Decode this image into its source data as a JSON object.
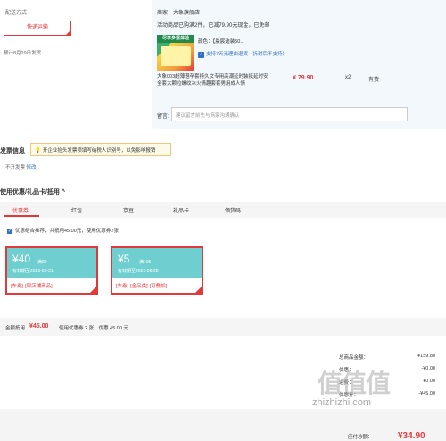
{
  "shipping": {
    "title": "配送方式",
    "method": "快递运输",
    "date": "预计8月29日发货"
  },
  "order": {
    "merchant": "商家：大象旗舰店",
    "promo": "活动商品已购满2件，已减79.90元现金，已免邮",
    "thumb_text": "尽享多重体验",
    "color_line": "颜色：【晨宸迪装50...",
    "guarantee": "支持7天无理由退货（拆封后不支持）",
    "guarantee_icon": "shield-check-icon",
    "product_name": "大象003超薄避孕套持久女专用高潮延时装挺延时安全套大颗粒螺纹冰火情趣套套男用成人情",
    "price": "¥ 79.90",
    "qty": "x2",
    "stock": "有货",
    "note_label": "留言:",
    "note_placeholder": "建议留言前先与商家沟通确认"
  },
  "invoice": {
    "title": "发票信息",
    "tip": "开企业抬头发票须填写纳税人识别号，以免影响报销",
    "tip_icon": "lightbulb-icon",
    "status": "不开发票",
    "edit": "修改"
  },
  "coupons": {
    "title": "使用优惠/礼品卡/抵用 ^",
    "tabs": [
      "优惠券",
      "红包",
      "京豆",
      "礼品卡",
      "领货码"
    ],
    "active_tab": 0,
    "checkbox_text": "优惠组合推荐，共抵用45.00元，使用优惠券2张",
    "items": [
      {
        "amount": "¥40",
        "cond": "满89",
        "valid": "有效期至2023-08-31",
        "tags": [
          "[东券]",
          "[限店铺商品]"
        ]
      },
      {
        "amount": "¥5",
        "cond": "满105",
        "valid": "有效期至2023-08-28",
        "tags": [
          "[东券]",
          "[全品类]",
          "[可叠加]"
        ]
      }
    ],
    "sum_label": "金额抵用",
    "sum_amount": "¥45.00",
    "sum_detail": "使用优惠券 2 张，优惠 45.00 元"
  },
  "totals": {
    "rows": [
      {
        "label": "总商品金额：",
        "value": "¥159.80"
      },
      {
        "label": "优惠：",
        "value": "-¥0.00"
      },
      {
        "label": "运费：",
        "value": "¥0.00"
      },
      {
        "label": "优惠券：",
        "value": "-¥45.00"
      }
    ],
    "pay_label": "应付总额：",
    "pay_amount": "¥34.90"
  },
  "watermark": {
    "logo": "值值值",
    "url": "zhizhizhi.com"
  },
  "colors": {
    "accent": "#e4393c",
    "link": "#2f6fc5",
    "coupon": "#6fcfd0"
  }
}
